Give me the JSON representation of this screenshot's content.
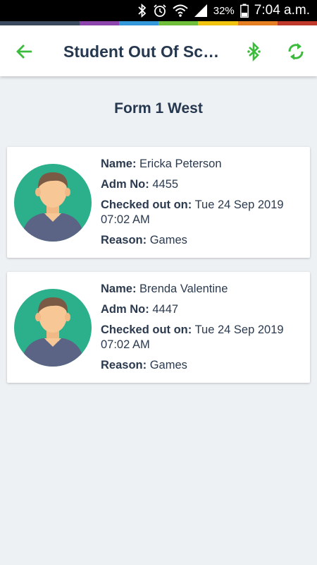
{
  "status_bar": {
    "battery_percent": "32%",
    "time": "7:04 a.m.",
    "icons": [
      "bluetooth-icon",
      "alarm-icon",
      "wifi-icon",
      "signal-icon",
      "battery-icon"
    ]
  },
  "stripe_colors": [
    "#3b4a5e",
    "#3b4a5e",
    "#8e44ad",
    "#3498db",
    "#6fbf3b",
    "#f1c40f",
    "#e67e22",
    "#c0392b"
  ],
  "app_bar": {
    "title": "Student Out Of Sch...",
    "back_icon": "arrow-left-icon",
    "bluetooth_icon": "bluetooth-icon",
    "sync_icon": "sync-icon",
    "accent": "#3dbb3d"
  },
  "class_name": "Form 1 West",
  "students": [
    {
      "name_label": "Name:",
      "name": "Ericka Peterson",
      "adm_label": "Adm No:",
      "adm_no": "4455",
      "checked_label": "Checked out on:",
      "checked_out": "Tue 24 Sep 2019 07:02 AM",
      "reason_label": "Reason:",
      "reason": "Games"
    },
    {
      "name_label": "Name:",
      "name": "Brenda Valentine",
      "adm_label": "Adm No:",
      "adm_no": "4447",
      "checked_label": "Checked out on:",
      "checked_out": "Tue 24 Sep 2019 07:02 AM",
      "reason_label": "Reason:",
      "reason": "Games"
    }
  ],
  "colors": {
    "avatar_bg": "#2bb08b",
    "avatar_shirt": "#5b6485",
    "avatar_skin": "#f7c896",
    "avatar_hair": "#7a5a44"
  }
}
